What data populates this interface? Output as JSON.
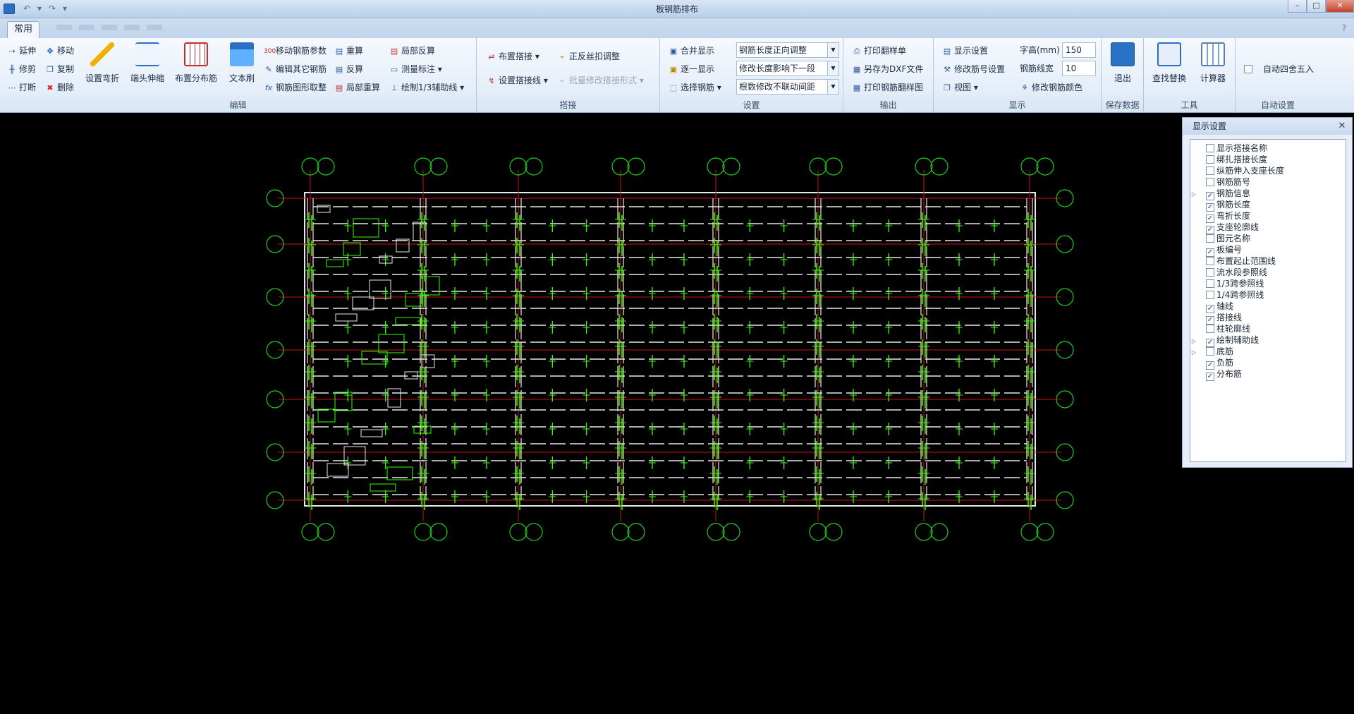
{
  "window": {
    "title": "板钢筋排布"
  },
  "tabs": {
    "home": "常用"
  },
  "groups": {
    "edit": {
      "label": "编辑",
      "extend": "延伸",
      "move": "移动",
      "trim": "修剪",
      "copy": "复制",
      "break": "打断",
      "delete": "删除",
      "set_bend": "设置弯折",
      "end_stretch": "端头伸缩",
      "layout_dist": "布置分布筋",
      "text_brush": "文本刷",
      "move_params": "移动钢筋参数",
      "edit_other": "编辑其它钢筋",
      "shape_take": "钢筋图形取整",
      "recalc": "重算",
      "backcalc": "反算",
      "local_recalc": "局部重算",
      "local_backcalc": "局部反算",
      "measure": "测量标注",
      "draw_aux": "绘制1/3辅助线"
    },
    "lap": {
      "label": "搭接",
      "place_lap": "布置搭接",
      "set_lap_line": "设置搭接线",
      "thread_adjust": "正反丝扣调整",
      "batch_modify": "批量修改搭接形式"
    },
    "settings": {
      "label": "设置",
      "merge_show": "合并显示",
      "one_by_one": "逐一显示",
      "select_rebar": "选择钢筋",
      "dropdowns": [
        "钢筋长度正向调整",
        "修改长度影响下一段",
        "根数修改不联动间距"
      ]
    },
    "output": {
      "label": "输出",
      "print_list": "打印翻样单",
      "save_dxf": "另存为DXF文件",
      "print_sample": "打印钢筋翻样图"
    },
    "display": {
      "label": "显示",
      "display_settings": "显示设置",
      "modify_no_settings": "修改筋号设置",
      "view": "视图",
      "font_height_label": "字高(mm)",
      "font_height": "150",
      "line_width_label": "钢筋线宽",
      "line_width": "10",
      "modify_color": "修改钢筋颜色"
    },
    "save": {
      "label": "保存数据",
      "exit": "退出"
    },
    "tools": {
      "label": "工具",
      "find_replace": "查找替换",
      "calculator": "计算器"
    },
    "auto": {
      "label": "自动设置",
      "auto_round": "自动四舍五入"
    }
  },
  "panel": {
    "title": "显示设置",
    "items": [
      {
        "label": "显示搭接名称",
        "checked": false,
        "expandable": false
      },
      {
        "label": "绑扎搭接长度",
        "checked": false,
        "expandable": false
      },
      {
        "label": "纵筋伸入支座长度",
        "checked": false,
        "expandable": false
      },
      {
        "label": "钢筋筋号",
        "checked": false,
        "expandable": false
      },
      {
        "label": "钢筋信息",
        "checked": true,
        "expandable": true
      },
      {
        "label": "钢筋长度",
        "checked": true,
        "expandable": false
      },
      {
        "label": "弯折长度",
        "checked": true,
        "expandable": false
      },
      {
        "label": "支座轮廓线",
        "checked": true,
        "expandable": false
      },
      {
        "label": "图元名称",
        "checked": false,
        "expandable": false
      },
      {
        "label": "板编号",
        "checked": true,
        "expandable": false
      },
      {
        "label": "布置起止范围线",
        "checked": false,
        "expandable": false
      },
      {
        "label": "流水段参照线",
        "checked": false,
        "expandable": false
      },
      {
        "label": "1/3跨参照线",
        "checked": false,
        "expandable": false
      },
      {
        "label": "1/4跨参照线",
        "checked": false,
        "expandable": false
      },
      {
        "label": "轴线",
        "checked": true,
        "expandable": false
      },
      {
        "label": "搭接线",
        "checked": true,
        "expandable": false
      },
      {
        "label": "柱轮廓线",
        "checked": false,
        "expandable": false
      },
      {
        "label": "绘制辅助线",
        "checked": true,
        "expandable": true
      },
      {
        "label": "底筋",
        "checked": false,
        "expandable": true
      },
      {
        "label": "负筋",
        "checked": true,
        "expandable": false
      },
      {
        "label": "分布筋",
        "checked": true,
        "expandable": false
      }
    ]
  },
  "colors": {
    "axis": "#c81414",
    "rebar": "#33ff00",
    "bar_white": "#e8e8e8",
    "circle": "#1fcc1f"
  }
}
